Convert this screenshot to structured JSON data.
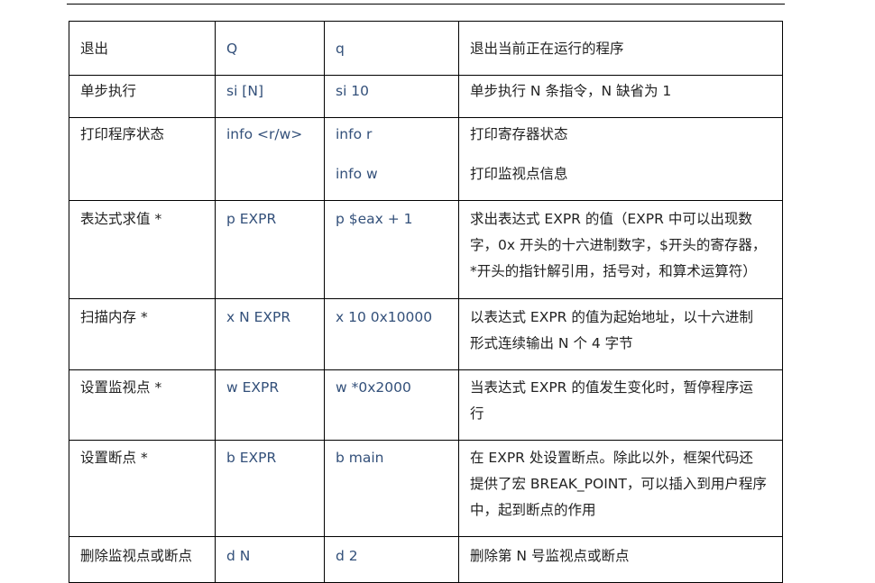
{
  "rows": [
    {
      "cmd": "退出",
      "star": "",
      "format": "Q",
      "examples": [
        "q"
      ],
      "desc": [
        [
          "退出当前正在运行的程序"
        ]
      ]
    },
    {
      "cmd": "单步执行",
      "star": "",
      "format": "si [N]",
      "examples": [
        "si 10"
      ],
      "desc": [
        [
          "单步执行 N 条指令，N 缺省为 1"
        ]
      ]
    },
    {
      "cmd": "打印程序状态",
      "star": "",
      "format": "info <r/w>",
      "examples": [
        "info r",
        "info w"
      ],
      "desc": [
        [
          "打印寄存器状态"
        ],
        [
          "打印监视点信息"
        ]
      ]
    },
    {
      "cmd": "表达式求值",
      "star": "*",
      "format": "p EXPR",
      "examples": [
        "p $eax + 1"
      ],
      "desc": [
        [
          "求出表达式 EXPR 的值（EXPR 中可以出现数",
          "字，0x 开头的十六进制数字，$开头的寄存器，",
          "*开头的指针解引用，括号对，和算术运算符）"
        ]
      ]
    },
    {
      "cmd": "扫描内存",
      "star": "*",
      "format": "x N EXPR",
      "examples": [
        "x 10 0x10000"
      ],
      "desc": [
        [
          "以表达式 EXPR 的值为起始地址，以十六进制",
          "形式连续输出 N 个 4 字节"
        ]
      ]
    },
    {
      "cmd": "设置监视点",
      "star": "*",
      "format": "w EXPR",
      "examples": [
        "w *0x2000"
      ],
      "desc": [
        [
          "当表达式 EXPR 的值发生变化时，暂停程序运",
          "行"
        ]
      ]
    },
    {
      "cmd": "设置断点",
      "star": "*",
      "format": "b EXPR",
      "examples": [
        "b main"
      ],
      "desc": [
        [
          "在 EXPR 处设置断点。除此以外，框架代码还",
          "提供了宏 BREAK_POINT，可以插入到用户程序",
          "中，起到断点的作用"
        ]
      ]
    },
    {
      "cmd": "删除监视点或断点",
      "star": "",
      "format": "d N",
      "examples": [
        "d 2"
      ],
      "desc": [
        [
          "删除第 N 号监视点或断点"
        ]
      ]
    }
  ]
}
